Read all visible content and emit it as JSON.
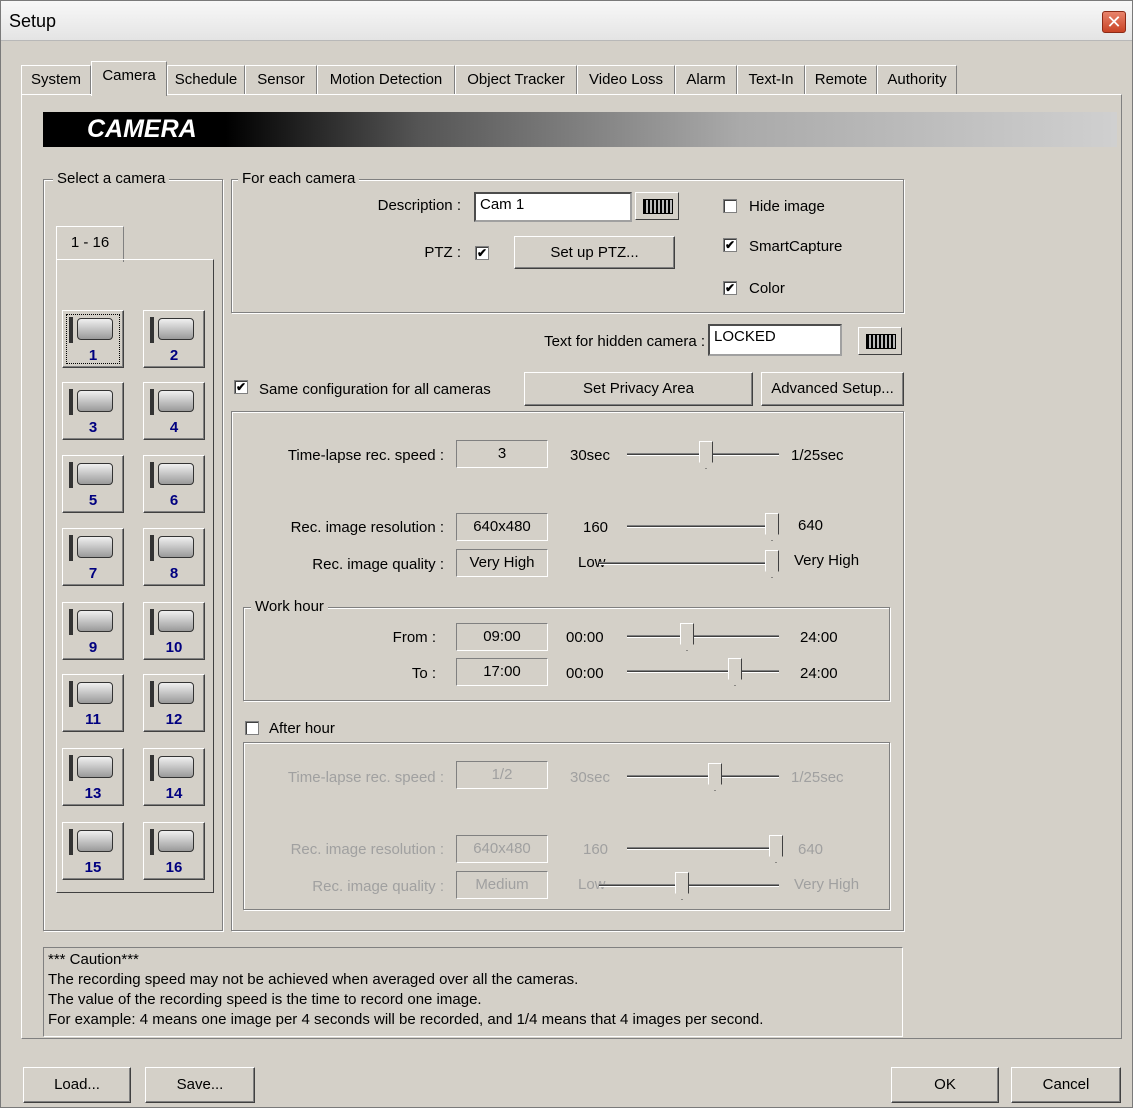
{
  "window": {
    "title": "Setup"
  },
  "tabs": [
    "System",
    "Camera",
    "Schedule",
    "Sensor",
    "Motion Detection",
    "Object Tracker",
    "Video Loss",
    "Alarm",
    "Text-In",
    "Remote",
    "Authority"
  ],
  "banner": "CAMERA",
  "select_camera": {
    "group_label": "Select a camera",
    "range_tab": "1 - 16",
    "cameras": [
      "1",
      "2",
      "3",
      "4",
      "5",
      "6",
      "7",
      "8",
      "9",
      "10",
      "11",
      "12",
      "13",
      "14",
      "15",
      "16"
    ]
  },
  "for_each": {
    "group_label": "For each camera",
    "description_label": "Description :",
    "description_value": "Cam 1",
    "ptz_label": "PTZ :",
    "ptz_checked": true,
    "setup_ptz_label": "Set up PTZ...",
    "hide_image_label": "Hide image",
    "hide_image_checked": false,
    "smartcapture_label": "SmartCapture",
    "smartcapture_checked": true,
    "color_label": "Color",
    "color_checked": true
  },
  "hidden_text": {
    "label": "Text for hidden camera :",
    "value": "LOCKED"
  },
  "same_config": {
    "label": "Same configuration for all cameras",
    "checked": true
  },
  "privacy_button": "Set Privacy Area",
  "advanced_button": "Advanced Setup...",
  "recording": {
    "timelapse_label": "Time-lapse rec. speed :",
    "timelapse_value": "3",
    "timelapse_min": "30sec",
    "timelapse_max": "1/25sec",
    "resolution_label": "Rec. image resolution :",
    "resolution_value": "640x480",
    "resolution_min": "160",
    "resolution_max": "640",
    "quality_label": "Rec. image quality :",
    "quality_value": "Very High",
    "quality_min": "Low",
    "quality_max": "Very High"
  },
  "work_hour": {
    "group_label": "Work hour",
    "from_label": "From :",
    "from_value": "09:00",
    "to_label": "To :",
    "to_value": "17:00",
    "min": "00:00",
    "max": "24:00"
  },
  "after_hour": {
    "label": "After hour",
    "checked": false,
    "timelapse_label": "Time-lapse rec. speed :",
    "timelapse_value": "1/2",
    "timelapse_min": "30sec",
    "timelapse_max": "1/25sec",
    "resolution_label": "Rec. image resolution :",
    "resolution_value": "640x480",
    "resolution_min": "160",
    "resolution_max": "640",
    "quality_label": "Rec. image quality :",
    "quality_value": "Medium",
    "quality_min": "Low",
    "quality_max": "Very High"
  },
  "caution": {
    "title": "*** Caution***",
    "lines": [
      "The recording speed may not be achieved when averaged over all the cameras.",
      "The value of the recording speed is the time to record one image.",
      "For example: 4 means one image per 4 seconds will be recorded, and 1/4 means that 4 images per second."
    ]
  },
  "footer": {
    "load": "Load...",
    "save": "Save...",
    "ok": "OK",
    "cancel": "Cancel"
  }
}
